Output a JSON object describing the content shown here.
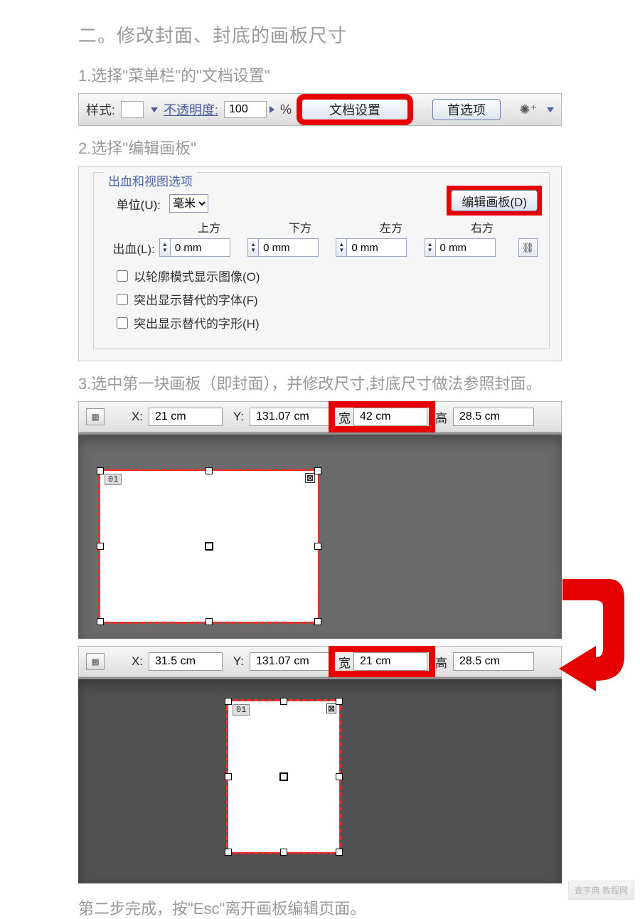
{
  "section_title": "二。修改封面、封底的画板尺寸",
  "step1": "1.选择\"菜单栏\"的\"文档设置\"",
  "step2": "2.选择\"编辑画板\"",
  "step3": "3.选中第一块画板（即封面），并修改尺寸,封底尺寸做法参照封面。",
  "footer": "第二步完成，按\"Esc\"离开画板编辑页面。",
  "toolbar": {
    "style_label": "样式:",
    "opacity_label": "不透明度:",
    "opacity_value": "100",
    "percent": "%",
    "doc_setup_btn": "文档设置",
    "prefs_btn": "首选项"
  },
  "panel": {
    "group_label": "出血和视图选项",
    "unit_label": "单位(U):",
    "unit_value": "毫米",
    "edit_artboard_btn": "编辑画板(D)",
    "bleed_label": "出血(L):",
    "bleed_heads": [
      "上方",
      "下方",
      "左方",
      "右方"
    ],
    "bleed_values": [
      "0 mm",
      "0 mm",
      "0 mm",
      "0 mm"
    ],
    "checks": [
      "以轮廓模式显示图像(O)",
      "突出显示替代的字体(F)",
      "突出显示替代的字形(H)"
    ]
  },
  "artcontrol_a": {
    "x_label": "X:",
    "x_value": "21 cm",
    "y_label": "Y:",
    "y_value": "131.07 cm",
    "w_label": "宽",
    "w_value": "42 cm",
    "h_label": "高",
    "h_value": "28.5 cm",
    "artboard_label": "01"
  },
  "artcontrol_b": {
    "x_label": "X:",
    "x_value": "31.5 cm",
    "y_label": "Y:",
    "y_value": "131.07 cm",
    "w_label": "宽",
    "w_value": "21 cm",
    "h_label": "高",
    "h_value": "28.5 cm",
    "artboard_label": "01"
  },
  "watermark": "查字典 教程网"
}
